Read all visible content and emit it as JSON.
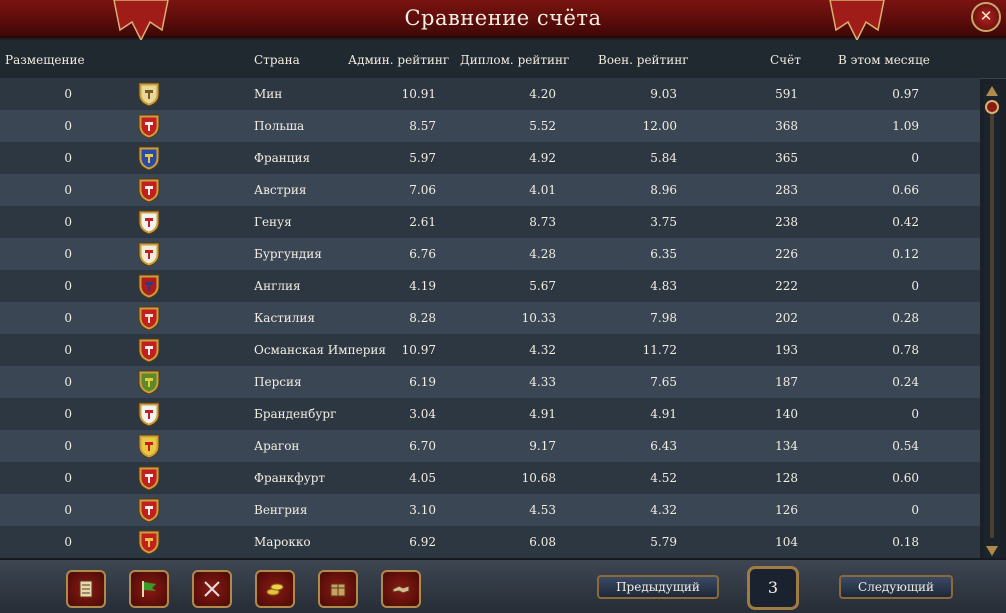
{
  "window": {
    "title": "Сравнение счёта",
    "close_glyph": "✕"
  },
  "columns": {
    "placement": "Размещение",
    "country": "Страна",
    "admin": "Админ. рейтинг",
    "diplo": "Диплом. рейтинг",
    "mil": "Воен. рейтинг",
    "score": "Счёт",
    "month": "В этом месяце"
  },
  "rows": [
    {
      "placement": "0",
      "country": "Мин",
      "admin": "10.91",
      "diplo": "4.20",
      "mil": "9.03",
      "score": "591",
      "month": "0.97",
      "flag": {
        "icon": "ming-shield-icon",
        "bg": "#e8d89a",
        "fg": "#7a5a20"
      }
    },
    {
      "placement": "0",
      "country": "Польша",
      "admin": "8.57",
      "diplo": "5.52",
      "mil": "12.00",
      "score": "368",
      "month": "1.09",
      "flag": {
        "icon": "poland-shield-icon",
        "bg": "#c41e1e",
        "fg": "#f2f2f2"
      }
    },
    {
      "placement": "0",
      "country": "Франция",
      "admin": "5.97",
      "diplo": "4.92",
      "mil": "5.84",
      "score": "365",
      "month": "0",
      "flag": {
        "icon": "france-shield-icon",
        "bg": "#2a4aa8",
        "fg": "#e8c840"
      }
    },
    {
      "placement": "0",
      "country": "Австрия",
      "admin": "7.06",
      "diplo": "4.01",
      "mil": "8.96",
      "score": "283",
      "month": "0.66",
      "flag": {
        "icon": "austria-shield-icon",
        "bg": "#c41e1e",
        "fg": "#f2f2f2"
      }
    },
    {
      "placement": "0",
      "country": "Генуя",
      "admin": "2.61",
      "diplo": "8.73",
      "mil": "3.75",
      "score": "238",
      "month": "0.42",
      "flag": {
        "icon": "genoa-shield-icon",
        "bg": "#f2f2f2",
        "fg": "#c41e1e"
      }
    },
    {
      "placement": "0",
      "country": "Бургундия",
      "admin": "6.76",
      "diplo": "4.28",
      "mil": "6.35",
      "score": "226",
      "month": "0.12",
      "flag": {
        "icon": "burgundy-shield-icon",
        "bg": "#f0ecdc",
        "fg": "#c41e1e"
      }
    },
    {
      "placement": "0",
      "country": "Англия",
      "admin": "4.19",
      "diplo": "5.67",
      "mil": "4.83",
      "score": "222",
      "month": "0",
      "flag": {
        "icon": "england-shield-icon",
        "bg": "#b01c1c",
        "fg": "#2a3a8a"
      }
    },
    {
      "placement": "0",
      "country": "Кастилия",
      "admin": "8.28",
      "diplo": "10.33",
      "mil": "7.98",
      "score": "202",
      "month": "0.28",
      "flag": {
        "icon": "castile-shield-icon",
        "bg": "#c41e1e",
        "fg": "#e8e0d0"
      }
    },
    {
      "placement": "0",
      "country": "Османская Империя",
      "admin": "10.97",
      "diplo": "4.32",
      "mil": "11.72",
      "score": "193",
      "month": "0.78",
      "flag": {
        "icon": "ottoman-shield-icon",
        "bg": "#c41e1e",
        "fg": "#f2f2f2"
      }
    },
    {
      "placement": "0",
      "country": "Персия",
      "admin": "6.19",
      "diplo": "4.33",
      "mil": "7.65",
      "score": "187",
      "month": "0.24",
      "flag": {
        "icon": "persia-shield-icon",
        "bg": "#5a8a2a",
        "fg": "#e8c840"
      }
    },
    {
      "placement": "0",
      "country": "Бранденбург",
      "admin": "3.04",
      "diplo": "4.91",
      "mil": "4.91",
      "score": "140",
      "month": "0",
      "flag": {
        "icon": "brandenburg-shield-icon",
        "bg": "#f2f2f2",
        "fg": "#c41e1e"
      }
    },
    {
      "placement": "0",
      "country": "Арагон",
      "admin": "6.70",
      "diplo": "9.17",
      "mil": "6.43",
      "score": "134",
      "month": "0.54",
      "flag": {
        "icon": "aragon-shield-icon",
        "bg": "#e8c840",
        "fg": "#c41e1e"
      }
    },
    {
      "placement": "0",
      "country": "Франкфурт",
      "admin": "4.05",
      "diplo": "10.68",
      "mil": "4.52",
      "score": "128",
      "month": "0.60",
      "flag": {
        "icon": "frankfurt-shield-icon",
        "bg": "#c41e1e",
        "fg": "#f2f2f2"
      }
    },
    {
      "placement": "0",
      "country": "Венгрия",
      "admin": "3.10",
      "diplo": "4.53",
      "mil": "4.32",
      "score": "126",
      "month": "0",
      "flag": {
        "icon": "hungary-shield-icon",
        "bg": "#c41e1e",
        "fg": "#f2f2f2"
      }
    },
    {
      "placement": "0",
      "country": "Марокко",
      "admin": "6.92",
      "diplo": "6.08",
      "mil": "5.79",
      "score": "104",
      "month": "0.18",
      "flag": {
        "icon": "morocco-shield-icon",
        "bg": "#c41e1e",
        "fg": "#e8c840"
      }
    }
  ],
  "toolbar": [
    {
      "icon": "ledger-icon"
    },
    {
      "icon": "flag-icon"
    },
    {
      "icon": "crossed-swords-icon"
    },
    {
      "icon": "coins-icon"
    },
    {
      "icon": "crate-icon"
    },
    {
      "icon": "handshake-icon"
    }
  ],
  "pagination": {
    "prev_label": "Предыдущий",
    "page": "3",
    "next_label": "Следующий"
  },
  "colors": {
    "title_red": "#7a1412",
    "row_dark": "#2d3742",
    "row_light": "#3a4654",
    "gold": "#b08a4a"
  }
}
